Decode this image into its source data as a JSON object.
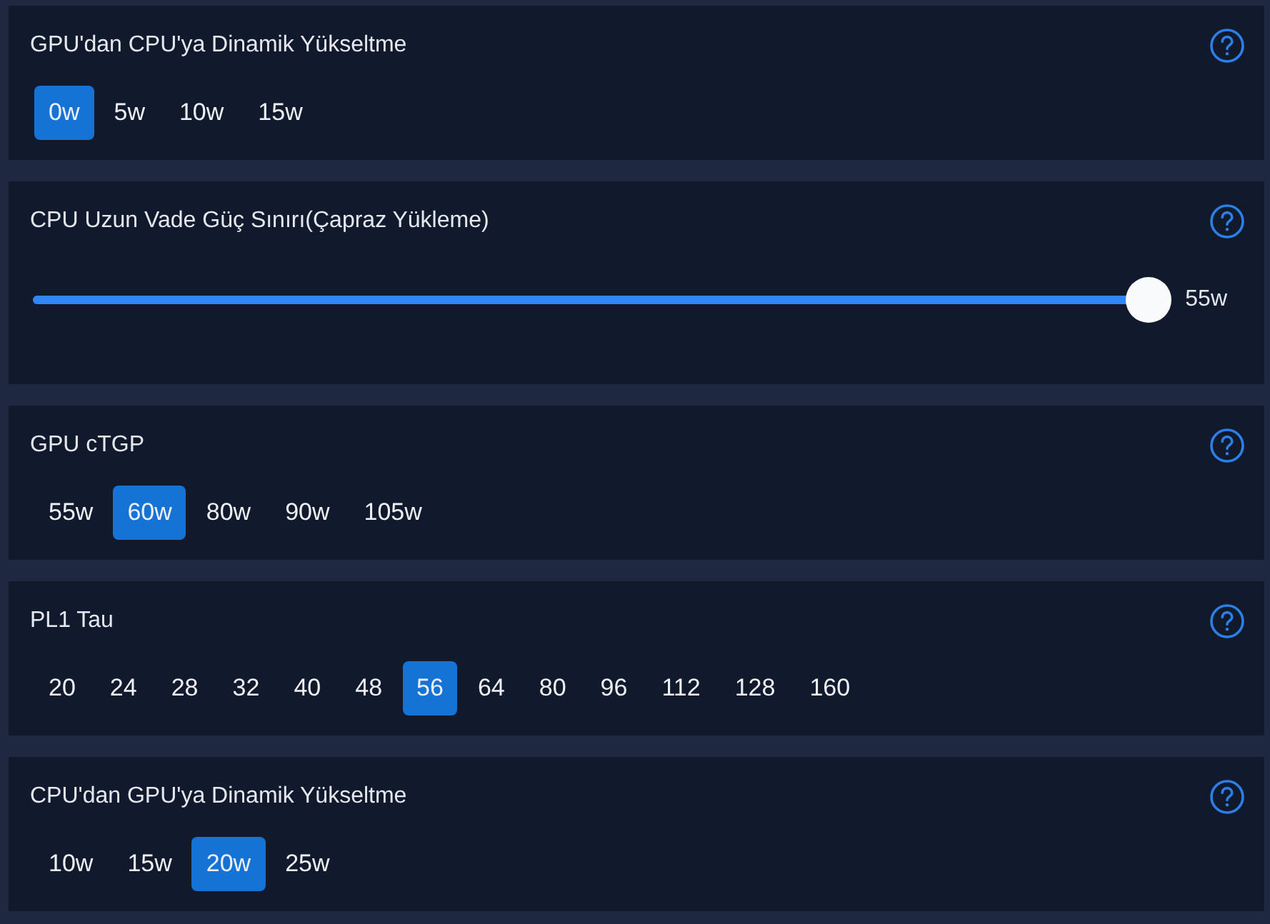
{
  "settings": [
    {
      "kind": "options",
      "title": "GPU'dan CPU'ya Dinamik Yükseltme",
      "options": [
        {
          "label": "0w",
          "selected": true
        },
        {
          "label": "5w",
          "selected": false
        },
        {
          "label": "10w",
          "selected": false
        },
        {
          "label": "15w",
          "selected": false
        }
      ]
    },
    {
      "kind": "slider",
      "title": "CPU Uzun Vade Güç Sınırı(Çapraz Yükleme)",
      "level": 1,
      "reading": "55w"
    },
    {
      "kind": "options",
      "title": "GPU cTGP",
      "options": [
        {
          "label": "55w",
          "selected": false
        },
        {
          "label": "60w",
          "selected": true
        },
        {
          "label": "80w",
          "selected": false
        },
        {
          "label": "90w",
          "selected": false
        },
        {
          "label": "105w",
          "selected": false
        }
      ]
    },
    {
      "kind": "options",
      "title": "PL1 Tau",
      "options": [
        {
          "label": "20",
          "selected": false
        },
        {
          "label": "24",
          "selected": false
        },
        {
          "label": "28",
          "selected": false
        },
        {
          "label": "32",
          "selected": false
        },
        {
          "label": "40",
          "selected": false
        },
        {
          "label": "48",
          "selected": false
        },
        {
          "label": "56",
          "selected": true
        },
        {
          "label": "64",
          "selected": false
        },
        {
          "label": "80",
          "selected": false
        },
        {
          "label": "96",
          "selected": false
        },
        {
          "label": "112",
          "selected": false
        },
        {
          "label": "128",
          "selected": false
        },
        {
          "label": "160",
          "selected": false
        }
      ]
    },
    {
      "kind": "options",
      "title": "CPU'dan GPU'ya Dinamik Yükseltme",
      "options": [
        {
          "label": "10w",
          "selected": false
        },
        {
          "label": "15w",
          "selected": false
        },
        {
          "label": "20w",
          "selected": true
        },
        {
          "label": "25w",
          "selected": false
        }
      ]
    }
  ]
}
